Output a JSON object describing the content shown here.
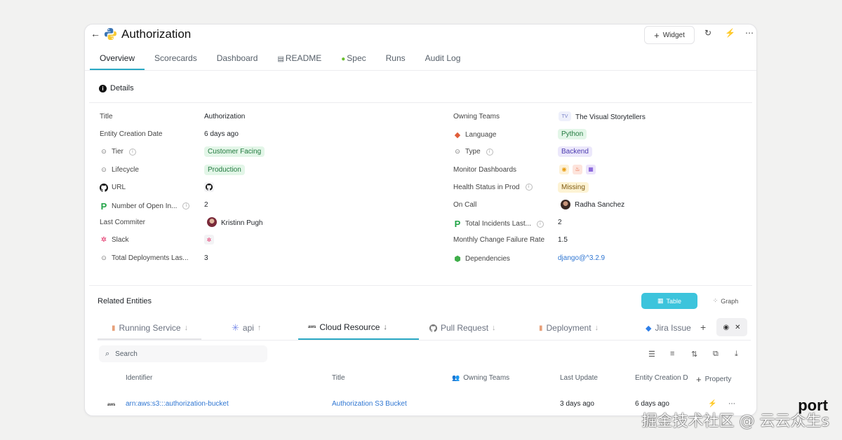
{
  "header": {
    "back": "←",
    "title": "Authorization",
    "widget_button": "Widget",
    "refresh_glyph": "↻",
    "lightning_glyph": "⚡",
    "more_glyph": "⋯"
  },
  "tabs": [
    {
      "label": "Overview",
      "icon": ""
    },
    {
      "label": "Scorecards",
      "icon": ""
    },
    {
      "label": "Dashboard",
      "icon": ""
    },
    {
      "label": "README",
      "icon": "▤"
    },
    {
      "label": "Spec",
      "icon": "●"
    },
    {
      "label": "Runs",
      "icon": ""
    },
    {
      "label": "Audit Log",
      "icon": ""
    }
  ],
  "details": {
    "heading": "Details",
    "left": [
      {
        "label": "Title",
        "value": "Authorization"
      },
      {
        "label": "Entity Creation Date",
        "value": "6 days ago"
      },
      {
        "label": "Tier",
        "value": "Customer Facing"
      },
      {
        "label": "Lifecycle",
        "value": "Production"
      },
      {
        "label": "URL",
        "value": ""
      },
      {
        "label": "Number of Open In...",
        "value": "2"
      },
      {
        "label": "Last Commiter",
        "value": "Kristinn Pugh"
      },
      {
        "label": "Slack",
        "value": ""
      },
      {
        "label": "Total Deployments Las...",
        "value": "3"
      }
    ],
    "right": [
      {
        "label": "Owning Teams",
        "value": "The Visual Storytellers",
        "badge": "TV"
      },
      {
        "label": "Language",
        "value": "Python"
      },
      {
        "label": "Type",
        "value": "Backend"
      },
      {
        "label": "Monitor Dashboards",
        "value": ""
      },
      {
        "label": "Health Status in Prod",
        "value": "Missing"
      },
      {
        "label": "On Call",
        "value": "Radha Sanchez"
      },
      {
        "label": "Total Incidents Last...",
        "value": "2"
      },
      {
        "label": "Monthly Change Failure Rate",
        "value": "1.5"
      },
      {
        "label": "Dependencies",
        "value": "django@^3.2.9"
      }
    ]
  },
  "related": {
    "title": "Related Entities",
    "view_table": "Table",
    "view_graph": "Graph",
    "tabs": [
      {
        "label": "Running Service",
        "arrow": "↓"
      },
      {
        "label": "api",
        "arrow": "↑"
      },
      {
        "label": "Cloud Resource",
        "arrow": "↓"
      },
      {
        "label": "Pull Request",
        "arrow": "↓"
      },
      {
        "label": "Deployment",
        "arrow": "↓"
      },
      {
        "label": "Jira Issue",
        "arrow": ""
      }
    ],
    "search_placeholder": "Search",
    "columns": [
      "Identifier",
      "Title",
      "Owning Teams",
      "Last Update",
      "Entity Creation D",
      "Property"
    ],
    "rows": [
      {
        "identifier": "arn:aws:s3:::authorization-bucket",
        "title": "Authorization S3 Bucket",
        "owning_teams": "",
        "last_update": "3 days ago",
        "created": "6 days ago"
      }
    ]
  },
  "watermark": {
    "brand": "port",
    "text": "掘金技术社区 @ 云云众生s"
  },
  "colors": {
    "accent": "#2aa8c4",
    "toggle_active": "#3cc4dc",
    "link": "#2f76d2"
  }
}
